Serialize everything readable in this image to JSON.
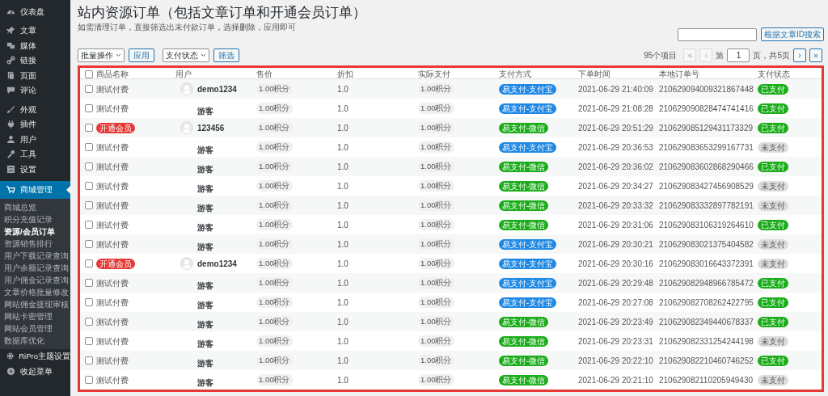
{
  "sidebar": {
    "items": [
      {
        "label": "仪表盘",
        "selected": false
      },
      {
        "label": "文章",
        "selected": false
      },
      {
        "label": "媒体",
        "selected": false
      },
      {
        "label": "链接",
        "selected": false
      },
      {
        "label": "页面",
        "selected": false
      },
      {
        "label": "评论",
        "selected": false
      },
      {
        "label": "外观",
        "selected": false
      },
      {
        "label": "插件",
        "selected": false
      },
      {
        "label": "用户",
        "selected": false
      },
      {
        "label": "工具",
        "selected": false
      },
      {
        "label": "设置",
        "selected": false
      },
      {
        "label": "商城管理",
        "selected": true,
        "children": [
          {
            "label": "商城总览",
            "selected": false
          },
          {
            "label": "积分充值记录",
            "selected": false
          },
          {
            "label": "资源/会员订单",
            "selected": true
          },
          {
            "label": "资源销售排行",
            "selected": false
          },
          {
            "label": "用户下载记录查询",
            "selected": false
          },
          {
            "label": "用户余额记录查询",
            "selected": false
          },
          {
            "label": "用户佣金记录查询",
            "selected": false
          },
          {
            "label": "文章价格批量修改",
            "selected": false
          },
          {
            "label": "网站佣金提现审核",
            "selected": false
          },
          {
            "label": "网站卡密管理",
            "selected": false
          },
          {
            "label": "网站会员管理",
            "selected": false
          },
          {
            "label": "数据库优化",
            "selected": false
          }
        ]
      },
      {
        "label": "RiPro主题设置",
        "selected": false
      },
      {
        "label": "收起菜单",
        "selected": false
      }
    ]
  },
  "page": {
    "title": "站内资源订单（包括文章订单和开通会员订单）",
    "subtitle": "如需清理订单，直接筛选出未付款订单，选择删除，应用即可"
  },
  "toolbar": {
    "bulk_select": "批量操作",
    "apply": "应用",
    "status_select": "支付状态",
    "filter": "筛选",
    "search_button": "根据文章ID搜索",
    "item_count": "95个项目",
    "first": "«",
    "prev": "‹",
    "page_prefix": "第",
    "page_value": "1",
    "page_suffix": "页，共5页",
    "next": "›",
    "last": "»"
  },
  "table": {
    "select_all_checked": false,
    "columns": [
      "商品名称",
      "用户",
      "售价",
      "折扣",
      "实际支付",
      "支付方式",
      "下单时间",
      "本地订单号",
      "支付状态"
    ],
    "rows": [
      {
        "checked": false,
        "name": "测试付费",
        "member": false,
        "user": "demo1234",
        "avatar": true,
        "price": "1.00积分",
        "discount": "1.0",
        "paid_amount": "1.00积分",
        "method": {
          "text": "易支付-支付宝",
          "color": "#1e88e5"
        },
        "time": "2021-06-29 21:40:09",
        "order_no": "210629094009321867448",
        "status": "已支付",
        "paid": true
      },
      {
        "name": "测试付费",
        "member": false,
        "user": "游客",
        "avatar": false,
        "price": "1.00积分",
        "discount": "1.0",
        "paid_amount": "1.00积分",
        "method": {
          "text": "易支付-支付宝",
          "color": "#1e88e5"
        },
        "time": "2021-06-29 21:08:28",
        "checked": false,
        "order_no": "210629090828474741416",
        "status": "已支付",
        "paid": true
      },
      {
        "name": "开通会员",
        "member": true,
        "user": "123456",
        "avatar": true,
        "price": "1.00积分",
        "discount": "1.0",
        "paid_amount": "1.00积分",
        "method": {
          "text": "易支付-微信",
          "color": "#1aad19"
        },
        "time": "2021-06-29 20:51:29",
        "checked": false,
        "order_no": "210629085129431173329",
        "status": "已支付",
        "paid": true
      },
      {
        "name": "测试付费",
        "member": false,
        "user": "游客",
        "avatar": false,
        "price": "1.00积分",
        "discount": "1.0",
        "paid_amount": "1.00积分",
        "method": {
          "text": "易支付-支付宝",
          "color": "#1e88e5"
        },
        "time": "2021-06-29 20:36:53",
        "checked": false,
        "order_no": "210629083653299167731",
        "status": "未支付",
        "paid": false
      },
      {
        "name": "测试付费",
        "member": false,
        "user": "游客",
        "avatar": false,
        "price": "1.00积分",
        "discount": "1.0",
        "paid_amount": "1.00积分",
        "method": {
          "text": "易支付-微信",
          "color": "#1aad19"
        },
        "time": "2021-06-29 20:36:02",
        "checked": false,
        "order_no": "210629083602868290466",
        "status": "已支付",
        "paid": true
      },
      {
        "name": "测试付费",
        "member": false,
        "user": "游客",
        "avatar": false,
        "price": "1.00积分",
        "discount": "1.0",
        "paid_amount": "1.00积分",
        "method": {
          "text": "易支付-微信",
          "color": "#1aad19"
        },
        "time": "2021-06-29 20:34:27",
        "checked": false,
        "order_no": "210629083427456908529",
        "status": "未支付",
        "paid": false
      },
      {
        "name": "测试付费",
        "member": false,
        "user": "游客",
        "avatar": false,
        "price": "1.00积分",
        "discount": "1.0",
        "paid_amount": "1.00积分",
        "method": {
          "text": "易支付-微信",
          "color": "#1aad19"
        },
        "time": "2021-06-29 20:33:32",
        "checked": false,
        "order_no": "210629083332897782191",
        "status": "未支付",
        "paid": false
      },
      {
        "name": "测试付费",
        "member": false,
        "user": "游客",
        "avatar": false,
        "price": "1.00积分",
        "discount": "1.0",
        "paid_amount": "1.00积分",
        "method": {
          "text": "易支付-微信",
          "color": "#1aad19"
        },
        "time": "2021-06-29 20:31:06",
        "checked": false,
        "order_no": "210629083106319264610",
        "status": "已支付",
        "paid": true
      },
      {
        "name": "测试付费",
        "member": false,
        "user": "游客",
        "avatar": false,
        "price": "1.00积分",
        "discount": "1.0",
        "paid_amount": "1.00积分",
        "method": {
          "text": "易支付-支付宝",
          "color": "#1e88e5"
        },
        "time": "2021-06-29 20:30:21",
        "checked": false,
        "order_no": "210629083021375404582",
        "status": "未支付",
        "paid": false
      },
      {
        "name": "开通会员",
        "member": true,
        "user": "demo1234",
        "avatar": true,
        "price": "1.00积分",
        "discount": "1.0",
        "paid_amount": "1.00积分",
        "method": {
          "text": "易支付-支付宝",
          "color": "#1e88e5"
        },
        "time": "2021-06-29 20:30:16",
        "checked": false,
        "order_no": "210629083016643372391",
        "status": "未支付",
        "paid": false
      },
      {
        "name": "测试付费",
        "member": false,
        "user": "游客",
        "avatar": false,
        "price": "1.00积分",
        "discount": "1.0",
        "paid_amount": "1.00积分",
        "method": {
          "text": "易支付-支付宝",
          "color": "#1e88e5"
        },
        "time": "2021-06-29 20:29:48",
        "checked": false,
        "order_no": "210629082948966785472",
        "status": "已支付",
        "paid": true
      },
      {
        "name": "测试付费",
        "member": false,
        "user": "游客",
        "avatar": false,
        "price": "1.00积分",
        "discount": "1.0",
        "paid_amount": "1.00积分",
        "method": {
          "text": "易支付-支付宝",
          "color": "#1e88e5"
        },
        "time": "2021-06-29 20:27:08",
        "checked": false,
        "order_no": "210629082708262422795",
        "status": "已支付",
        "paid": true
      },
      {
        "name": "测试付费",
        "member": false,
        "user": "游客",
        "avatar": false,
        "price": "1.00积分",
        "discount": "1.0",
        "paid_amount": "1.00积分",
        "method": {
          "text": "易支付-微信",
          "color": "#1aad19"
        },
        "time": "2021-06-29 20:23:49",
        "checked": false,
        "order_no": "210629082349440678337",
        "status": "已支付",
        "paid": true
      },
      {
        "name": "测试付费",
        "member": false,
        "user": "游客",
        "avatar": false,
        "price": "1.00积分",
        "discount": "1.0",
        "paid_amount": "1.00积分",
        "method": {
          "text": "易支付-微信",
          "color": "#1aad19"
        },
        "time": "2021-06-29 20:23:31",
        "checked": false,
        "order_no": "210629082331254244198",
        "status": "未支付",
        "paid": false
      },
      {
        "name": "测试付费",
        "member": false,
        "user": "游客",
        "avatar": false,
        "price": "1.00积分",
        "discount": "1.0",
        "paid_amount": "1.00积分",
        "method": {
          "text": "易支付-微信",
          "color": "#1aad19"
        },
        "time": "2021-06-29 20:22:10",
        "checked": false,
        "order_no": "210629082210460746252",
        "status": "已支付",
        "paid": true
      },
      {
        "name": "测试付费",
        "member": false,
        "user": "游客",
        "avatar": false,
        "price": "1.00积分",
        "discount": "1.0",
        "paid_amount": "1.00积分",
        "method": {
          "text": "易支付-微信",
          "color": "#1aad19"
        },
        "time": "2021-06-29 20:21:10",
        "checked": false,
        "order_no": "210629082110205949430",
        "status": "未支付",
        "paid": false
      }
    ]
  }
}
